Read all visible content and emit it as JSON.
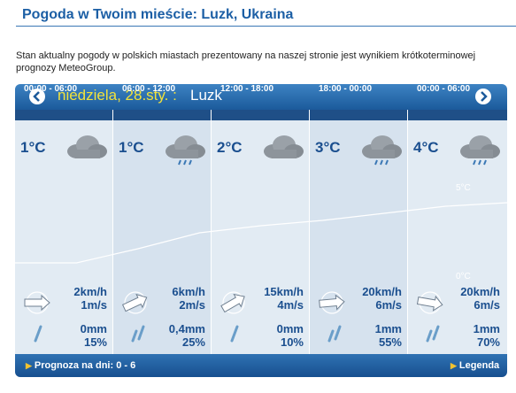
{
  "header": {
    "title": "Pogoda w Twoim mieście: Luzk, Ukraina"
  },
  "intro": "Stan aktualny pogody w polskich miastach prezentowany na naszej stronie jest wynikiem krótkoterminowej prognozy MeteoGroup.",
  "widget": {
    "date": "niedziela, 28.sty. :",
    "city": "Luzk",
    "periods": [
      {
        "time": "00:00 - 06:00",
        "temp": "1°C",
        "icon": "cloud-icon",
        "wind_speed_kmh": "2km/h",
        "wind_speed_ms": "1m/s",
        "precip_amount": "0mm",
        "precip_chance": "15%"
      },
      {
        "time": "06:00 - 12:00",
        "temp": "1°C",
        "icon": "cloud-rain-icon",
        "wind_speed_kmh": "6km/h",
        "wind_speed_ms": "2m/s",
        "precip_amount": "0,4mm",
        "precip_chance": "25%"
      },
      {
        "time": "12:00 - 18:00",
        "temp": "2°C",
        "icon": "cloud-icon",
        "wind_speed_kmh": "15km/h",
        "wind_speed_ms": "4m/s",
        "precip_amount": "0mm",
        "precip_chance": "10%"
      },
      {
        "time": "18:00 - 00:00",
        "temp": "3°C",
        "icon": "cloud-rain-icon",
        "wind_speed_kmh": "20km/h",
        "wind_speed_ms": "6m/s",
        "precip_amount": "1mm",
        "precip_chance": "55%"
      },
      {
        "time": "00:00 - 06:00",
        "temp": "4°C",
        "icon": "cloud-rain-icon",
        "wind_speed_kmh": "20km/h",
        "wind_speed_ms": "6m/s",
        "precip_amount": "1mm",
        "precip_chance": "70%"
      }
    ],
    "chart_labels": {
      "max": "5°C",
      "min": "0°C"
    },
    "temperature_curve": [
      1,
      1,
      1.8,
      2.7,
      3.1,
      3.4,
      3.8,
      4.2,
      4.4
    ],
    "footer": {
      "forecast_link": "Prognoza na dni: 0 - 6",
      "legend_link": "Legenda"
    }
  },
  "colors": {
    "title": "#1c5fa5",
    "value_text": "#1b4f8f",
    "date_text": "#f2e23b",
    "bar": "#1b5a9b"
  }
}
